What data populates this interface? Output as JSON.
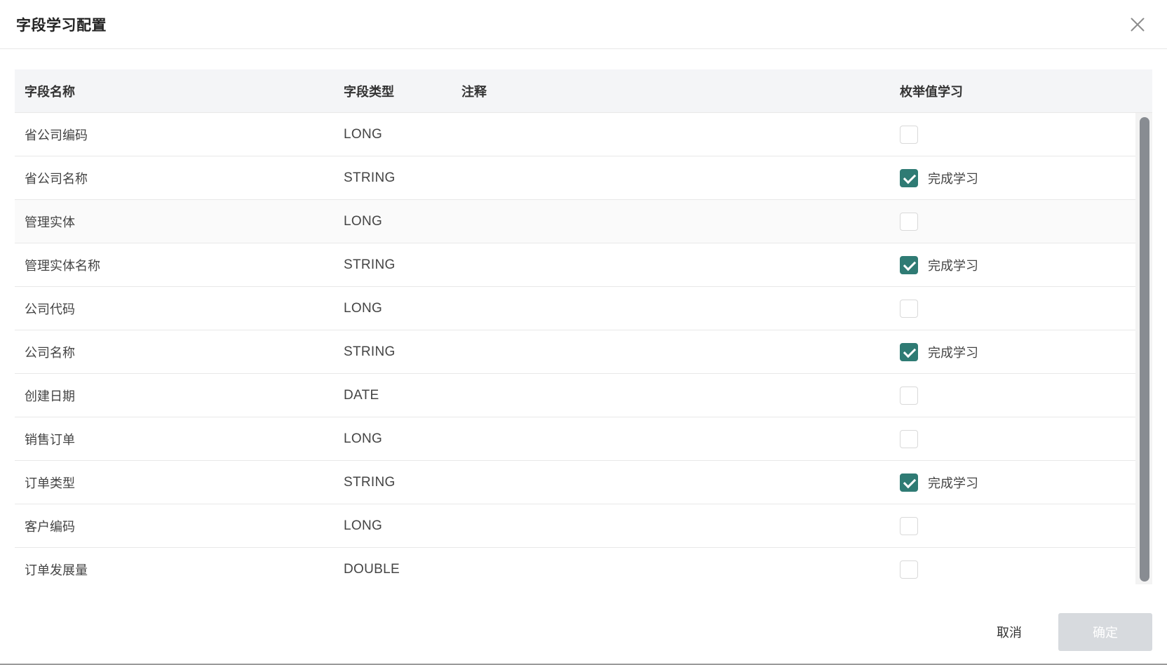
{
  "dialog": {
    "title": "字段学习配置",
    "close_icon": "close-icon"
  },
  "table": {
    "headers": {
      "name": "字段名称",
      "type": "字段类型",
      "comment": "注释",
      "enum_learning": "枚举值学习"
    },
    "rows": [
      {
        "name": "省公司编码",
        "type": "LONG",
        "comment": "",
        "checked": false,
        "status": ""
      },
      {
        "name": "省公司名称",
        "type": "STRING",
        "comment": "",
        "checked": true,
        "status": "完成学习"
      },
      {
        "name": "管理实体",
        "type": "LONG",
        "comment": "",
        "checked": false,
        "status": ""
      },
      {
        "name": "管理实体名称",
        "type": "STRING",
        "comment": "",
        "checked": true,
        "status": "完成学习"
      },
      {
        "name": "公司代码",
        "type": "LONG",
        "comment": "",
        "checked": false,
        "status": ""
      },
      {
        "name": "公司名称",
        "type": "STRING",
        "comment": "",
        "checked": true,
        "status": "完成学习"
      },
      {
        "name": "创建日期",
        "type": "DATE",
        "comment": "",
        "checked": false,
        "status": ""
      },
      {
        "name": "销售订单",
        "type": "LONG",
        "comment": "",
        "checked": false,
        "status": ""
      },
      {
        "name": "订单类型",
        "type": "STRING",
        "comment": "",
        "checked": true,
        "status": "完成学习"
      },
      {
        "name": "客户编码",
        "type": "LONG",
        "comment": "",
        "checked": false,
        "status": ""
      },
      {
        "name": "订单发展量",
        "type": "DOUBLE",
        "comment": "",
        "checked": false,
        "status": ""
      }
    ]
  },
  "footer": {
    "cancel_label": "取消",
    "confirm_label": "确定"
  },
  "colors": {
    "accent": "#2f7b74",
    "disabled_button": "#d7dade"
  }
}
